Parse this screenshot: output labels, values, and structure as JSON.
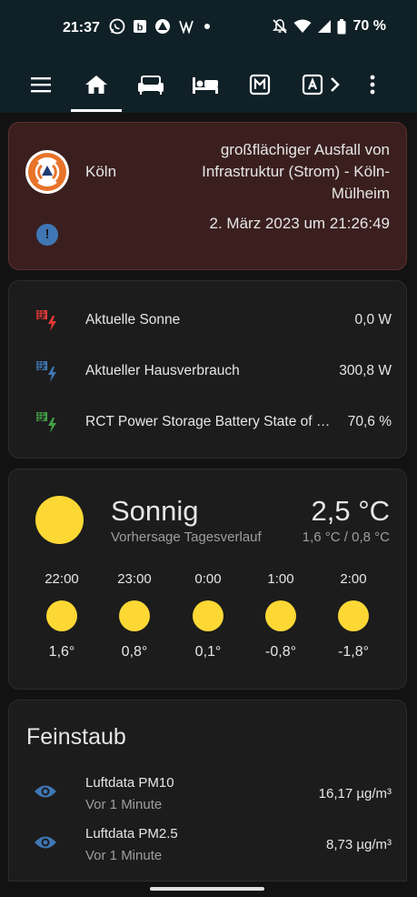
{
  "status_bar": {
    "time": "21:37",
    "notification_icons": [
      "whatsapp-icon",
      "b-app-icon",
      "triangle-app-icon",
      "w-app-icon",
      "dot"
    ],
    "battery_percent": "70 %"
  },
  "app_bar": {
    "tabs": [
      "home",
      "sofa",
      "bed",
      "m-app",
      "a-app"
    ],
    "active_tab": "home"
  },
  "alert": {
    "city": "Köln",
    "title": "großflächiger Ausfall von Infrastruktur (Strom) - Köln-Mülheim",
    "date": "2. März 2023 um 21:26:49",
    "info_glyph": "!"
  },
  "energy": {
    "rows": [
      {
        "label": "Aktuelle Sonne",
        "value": "0,0 W",
        "color": "#e53935"
      },
      {
        "label": "Aktueller Hausverbrauch",
        "value": "300,8 W",
        "color": "#3f77b5"
      },
      {
        "label": "RCT Power Storage Battery State of Charge",
        "value": "70,6 %",
        "color": "#43a047"
      }
    ]
  },
  "weather": {
    "state": "Sonnig",
    "subtitle": "Vorhersage Tagesverlauf",
    "temperature": "2,5 °C",
    "minmax": "1,6 °C / 0,8 °C",
    "forecast": [
      {
        "time": "22:00",
        "temp": "1,6°"
      },
      {
        "time": "23:00",
        "temp": "0,8°"
      },
      {
        "time": "0:00",
        "temp": "0,1°"
      },
      {
        "time": "1:00",
        "temp": "-0,8°"
      },
      {
        "time": "2:00",
        "temp": "-1,8°"
      }
    ]
  },
  "dust": {
    "title": "Feinstaub",
    "rows": [
      {
        "name": "Luftdata PM10",
        "sub": "Vor 1 Minute",
        "value": "16,17 µg/m³"
      },
      {
        "name": "Luftdata PM2.5",
        "sub": "Vor 1 Minute",
        "value": "8,73 µg/m³"
      }
    ]
  },
  "colors": {
    "accent_yellow": "#fdd835",
    "alert_bg": "#3b1f1f",
    "icon_blue": "#3f77b5"
  }
}
